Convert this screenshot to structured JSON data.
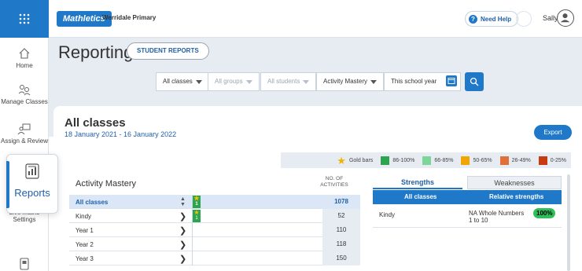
{
  "header": {
    "logo": "Mathletics",
    "school": "Werridale Primary",
    "help_label": "Need Help",
    "user_name": "Sally"
  },
  "sidebar": {
    "items": [
      {
        "label": "Home",
        "icon": "home-icon"
      },
      {
        "label": "Manage Classes",
        "icon": "manage-classes-icon"
      },
      {
        "label": "Assign & Review",
        "icon": "assign-review-icon"
      },
      {
        "label": "Reports",
        "icon": "reports-icon",
        "active": true
      },
      {
        "label": "Live Maths Settings",
        "icon": "live-maths-icon"
      },
      {
        "label": "",
        "icon": "book-icon"
      }
    ]
  },
  "page": {
    "title": "Reporting",
    "subtitle_button": "STUDENT REPORTS"
  },
  "filters": {
    "classes": "All classes",
    "groups": "All groups",
    "students": "All students",
    "report_type": "Activity Mastery",
    "period": "This school year"
  },
  "summary": {
    "title": "All classes",
    "date_range": "18 January 2021 - 16 January 2022",
    "export_label": "Export"
  },
  "legend": {
    "items": [
      {
        "label": "Gold bars",
        "color": "#f0b400",
        "kind": "star"
      },
      {
        "label": "86-100%",
        "color": "#2ea44f"
      },
      {
        "label": "66-85%",
        "color": "#7ed59a"
      },
      {
        "label": "50-65%",
        "color": "#f0a500"
      },
      {
        "label": "26-49%",
        "color": "#e0703a"
      },
      {
        "label": "0-25%",
        "color": "#c63b10"
      }
    ]
  },
  "mastery": {
    "title": "Activity Mastery",
    "count_header": "NO. OF ACTIVITIES",
    "rows": [
      {
        "name": "All classes",
        "count": "1078",
        "gold": "1",
        "head": true
      },
      {
        "name": "Kindy",
        "count": "52",
        "gold": "1"
      },
      {
        "name": "Year 1",
        "count": "110"
      },
      {
        "name": "Year 2",
        "count": "118"
      },
      {
        "name": "Year 3",
        "count": "150"
      }
    ]
  },
  "strengths": {
    "tab_active": "Strengths",
    "tab_inactive": "Weaknesses",
    "col_class": "All classes",
    "col_strength": "Relative strengths",
    "rows": [
      {
        "class": "Kindy",
        "skill_line1": "NA Whole Numbers",
        "skill_line2": "1 to 10",
        "percent": "100%"
      }
    ]
  }
}
